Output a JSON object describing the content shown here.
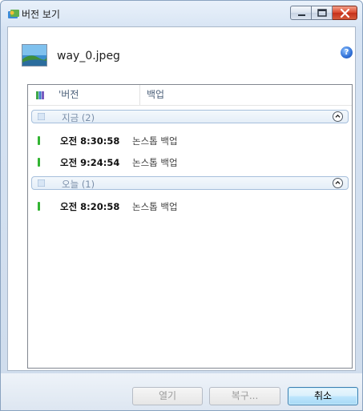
{
  "window": {
    "title": "버전 보기",
    "icon": "app-folder-icon"
  },
  "file": {
    "name": "way_0.jpeg",
    "icon": "image-file-icon"
  },
  "help": {
    "label": "?"
  },
  "list": {
    "columns": {
      "version": "'버전",
      "backup": "백업"
    },
    "groups": [
      {
        "label": "지금 (2)",
        "rows": [
          {
            "time": "오전 8:30:58",
            "type": "논스톱 백업"
          },
          {
            "time": "오전 9:24:54",
            "type": "논스톱 백업"
          }
        ]
      },
      {
        "label": "오늘 (1)",
        "rows": [
          {
            "time": "오전 8:20:58",
            "type": "논스톱 백업"
          }
        ]
      }
    ]
  },
  "buttons": {
    "open": "열기",
    "restore": "복구...",
    "cancel": "취소"
  },
  "colors": {
    "marker": "#32b432",
    "accent": "#3c7fb1",
    "close": "#c4301a"
  }
}
